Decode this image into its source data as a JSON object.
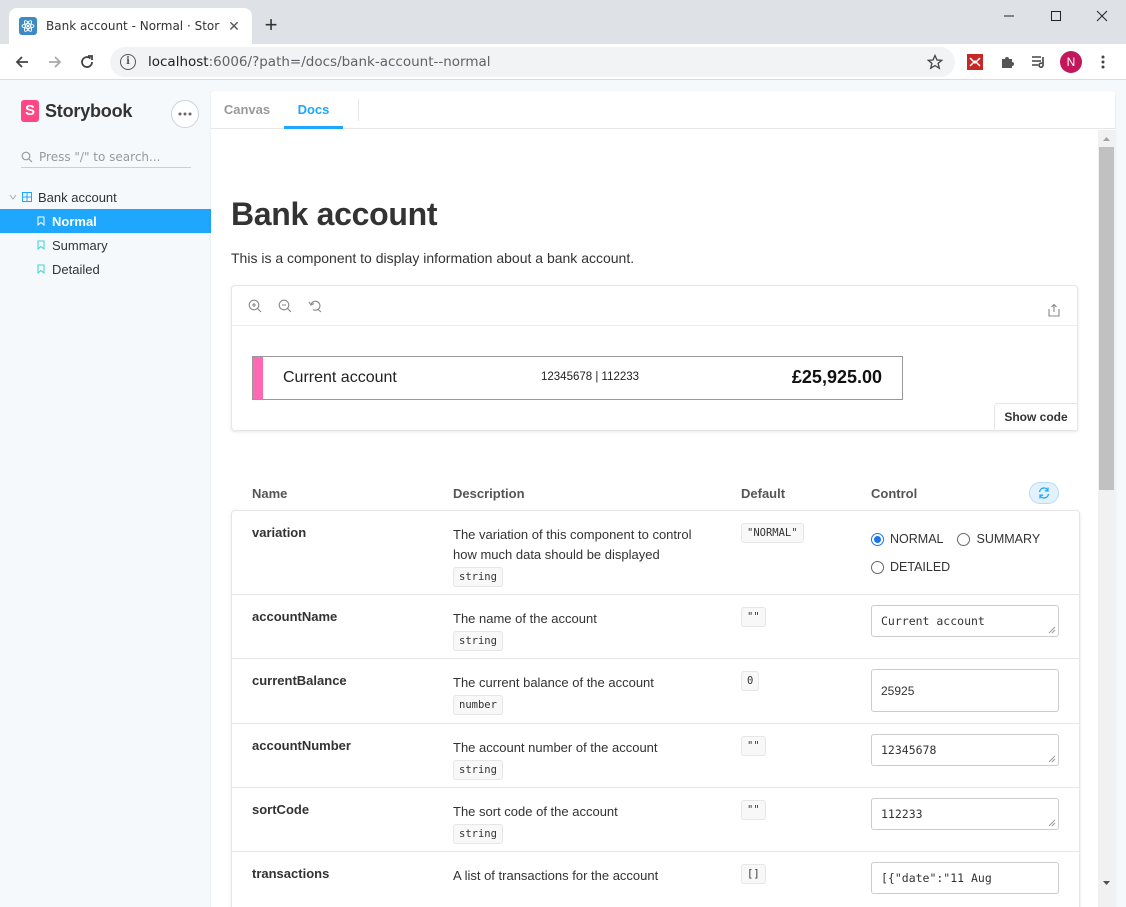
{
  "browser": {
    "tab_title": "Bank account - Normal · Storybook",
    "tab_close": "✕",
    "new_tab": "+",
    "url_host": "localhost",
    "url_path": ":6006/?path=/docs/bank-account--normal",
    "profile_initial": "N"
  },
  "storybook": {
    "logo_text": "Storybook",
    "logo_mark": "S",
    "search_placeholder": "Press \"/\" to search...",
    "tree": {
      "group": "Bank account",
      "stories": [
        "Normal",
        "Summary",
        "Detailed"
      ]
    },
    "tabs": [
      "Canvas",
      "Docs"
    ]
  },
  "docs": {
    "title": "Bank account",
    "description": "This is a component to display information about a bank account.",
    "preview": {
      "account_name": "Current account",
      "account_number": "12345678 | 112233",
      "balance": "£25,925.00",
      "show_code": "Show code",
      "stripe_color": "#ff69b4"
    },
    "args_headers": {
      "name": "Name",
      "description": "Description",
      "default": "Default",
      "control": "Control"
    },
    "args": [
      {
        "name": "variation",
        "description": "The variation of this component to control how much data should be displayed",
        "type": "string",
        "default": "\"NORMAL\"",
        "options": [
          "NORMAL",
          "SUMMARY",
          "DETAILED"
        ],
        "selected": "NORMAL"
      },
      {
        "name": "accountName",
        "description": "The name of the account",
        "type": "string",
        "default": "\"\"",
        "value": "Current account"
      },
      {
        "name": "currentBalance",
        "description": "The current balance of the account",
        "type": "number",
        "default": "0",
        "value": "25925"
      },
      {
        "name": "accountNumber",
        "description": "The account number of the account",
        "type": "string",
        "default": "\"\"",
        "value": "12345678"
      },
      {
        "name": "sortCode",
        "description": "The sort code of the account",
        "type": "string",
        "default": "\"\"",
        "value": "112233"
      },
      {
        "name": "transactions",
        "description": "A list of transactions for the account",
        "type": "",
        "default": "[]",
        "value": "[{\"date\":\"11 Aug"
      }
    ]
  },
  "colors": {
    "accent": "#1ea7fd",
    "storybook_pink": "#ff4785"
  }
}
